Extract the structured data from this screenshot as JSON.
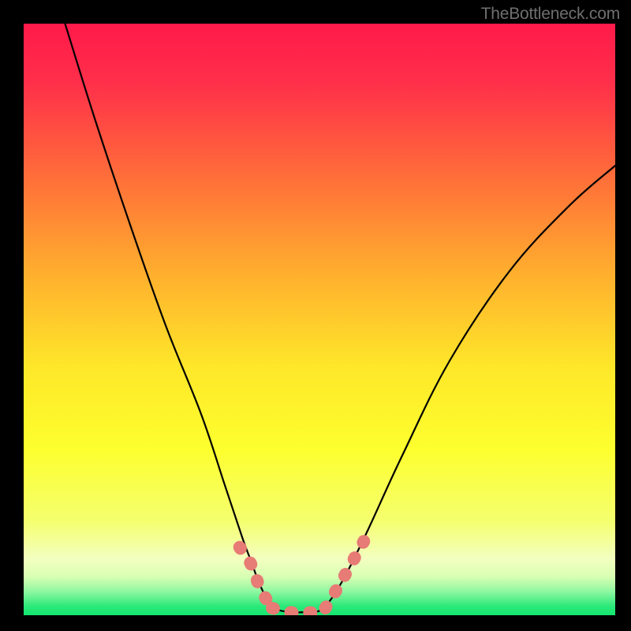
{
  "watermark": "TheBottleneck.com",
  "gradient_stops": [
    {
      "offset": 0.0,
      "color": "#ff1a4a"
    },
    {
      "offset": 0.1,
      "color": "#ff2f4a"
    },
    {
      "offset": 0.25,
      "color": "#ff6a3a"
    },
    {
      "offset": 0.42,
      "color": "#ffae2e"
    },
    {
      "offset": 0.58,
      "color": "#fee729"
    },
    {
      "offset": 0.72,
      "color": "#fdff2e"
    },
    {
      "offset": 0.84,
      "color": "#f4ff6e"
    },
    {
      "offset": 0.905,
      "color": "#f3ffc0"
    },
    {
      "offset": 0.935,
      "color": "#d8ffb3"
    },
    {
      "offset": 0.96,
      "color": "#8ef7a1"
    },
    {
      "offset": 0.985,
      "color": "#2be979"
    },
    {
      "offset": 1.0,
      "color": "#13e770"
    }
  ],
  "chart_data": {
    "type": "line",
    "title": "",
    "xlabel": "",
    "ylabel": "",
    "xlim": [
      0,
      100
    ],
    "ylim": [
      0,
      100
    ],
    "series": [
      {
        "name": "curve",
        "style": "black-thin",
        "x": [
          7,
          12,
          18,
          24,
          30,
          34,
          37,
          38.5,
          40,
          42,
          45,
          47,
          49,
          51,
          54,
          58,
          64,
          72,
          82,
          92,
          100
        ],
        "y": [
          100,
          84,
          66,
          49,
          34,
          22,
          13,
          9,
          5,
          1.5,
          0.5,
          0.5,
          0.5,
          1.5,
          6,
          14,
          27,
          43,
          58,
          69,
          76
        ]
      },
      {
        "name": "marker-band",
        "style": "salmon-thick",
        "segments": [
          {
            "x": [
              36.5,
              38.5,
              40,
              42
            ],
            "y": [
              11.5,
              8.5,
              4.5,
              1.2
            ]
          },
          {
            "x": [
              42,
              45,
              47,
              49,
              51
            ],
            "y": [
              1.2,
              0.5,
              0.5,
              0.5,
              1.2
            ]
          },
          {
            "x": [
              51,
              53,
              55,
              57.5
            ],
            "y": [
              1.2,
              4.5,
              8,
              12.5
            ]
          }
        ]
      }
    ]
  }
}
